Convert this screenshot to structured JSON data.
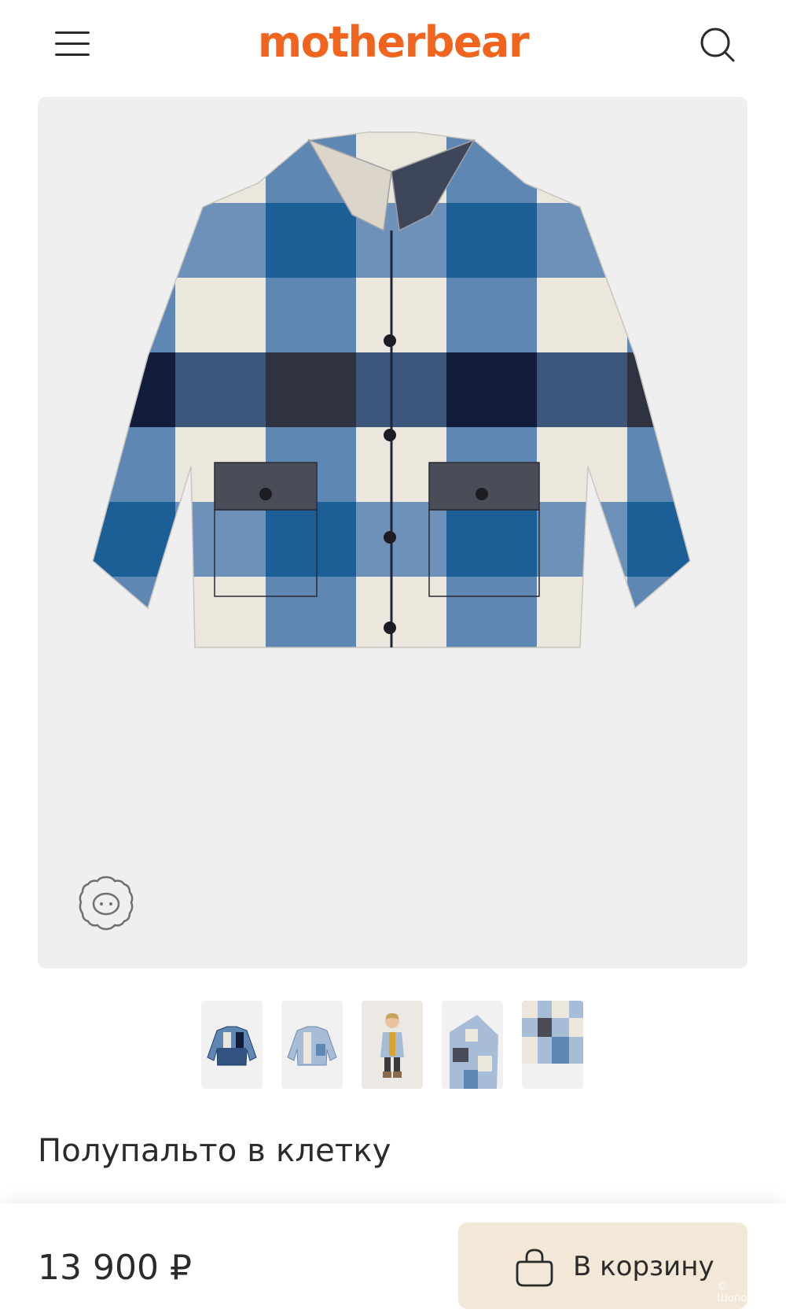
{
  "header": {
    "brand": "motherbear",
    "brand_color": "#f0641e",
    "menu_icon": "hamburger-menu-icon",
    "search_icon": "search-icon"
  },
  "gallery": {
    "main_image": "plaid-coat-photo",
    "badge_icon": "wool-sheep-icon",
    "thumbnails": [
      "thumbnail-coat-front-dark",
      "thumbnail-coat-front-light",
      "thumbnail-model-photo",
      "thumbnail-coat-fold",
      "thumbnail-fabric-closeup"
    ]
  },
  "product": {
    "title": "Полупальто в клетку",
    "price": "13 900 ₽"
  },
  "cart": {
    "label": "В корзину",
    "icon": "shopping-bag-icon",
    "button_color": "#f3e7d8"
  },
  "watermark": "© Шопоголик"
}
